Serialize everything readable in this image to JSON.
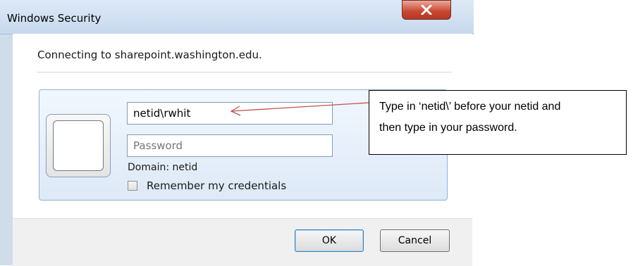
{
  "dialog": {
    "title": "Windows Security",
    "close_glyph": "X",
    "message": "Connecting to sharepoint.washington.edu.",
    "username_value": "netid\\rwhit",
    "password_placeholder": "Password",
    "domain_text": "Domain: netid",
    "remember_label": "Remember my credentials",
    "remember_checked": false,
    "ok_label": "OK",
    "cancel_label": "Cancel"
  },
  "callout": {
    "line1": "Type in ‘netid\\’ before your netid and",
    "line2": "then type in your password.",
    "arrow_color": "#c0504d"
  },
  "icons": {
    "close": "close-icon",
    "user_tile": "user-tile-icon"
  }
}
